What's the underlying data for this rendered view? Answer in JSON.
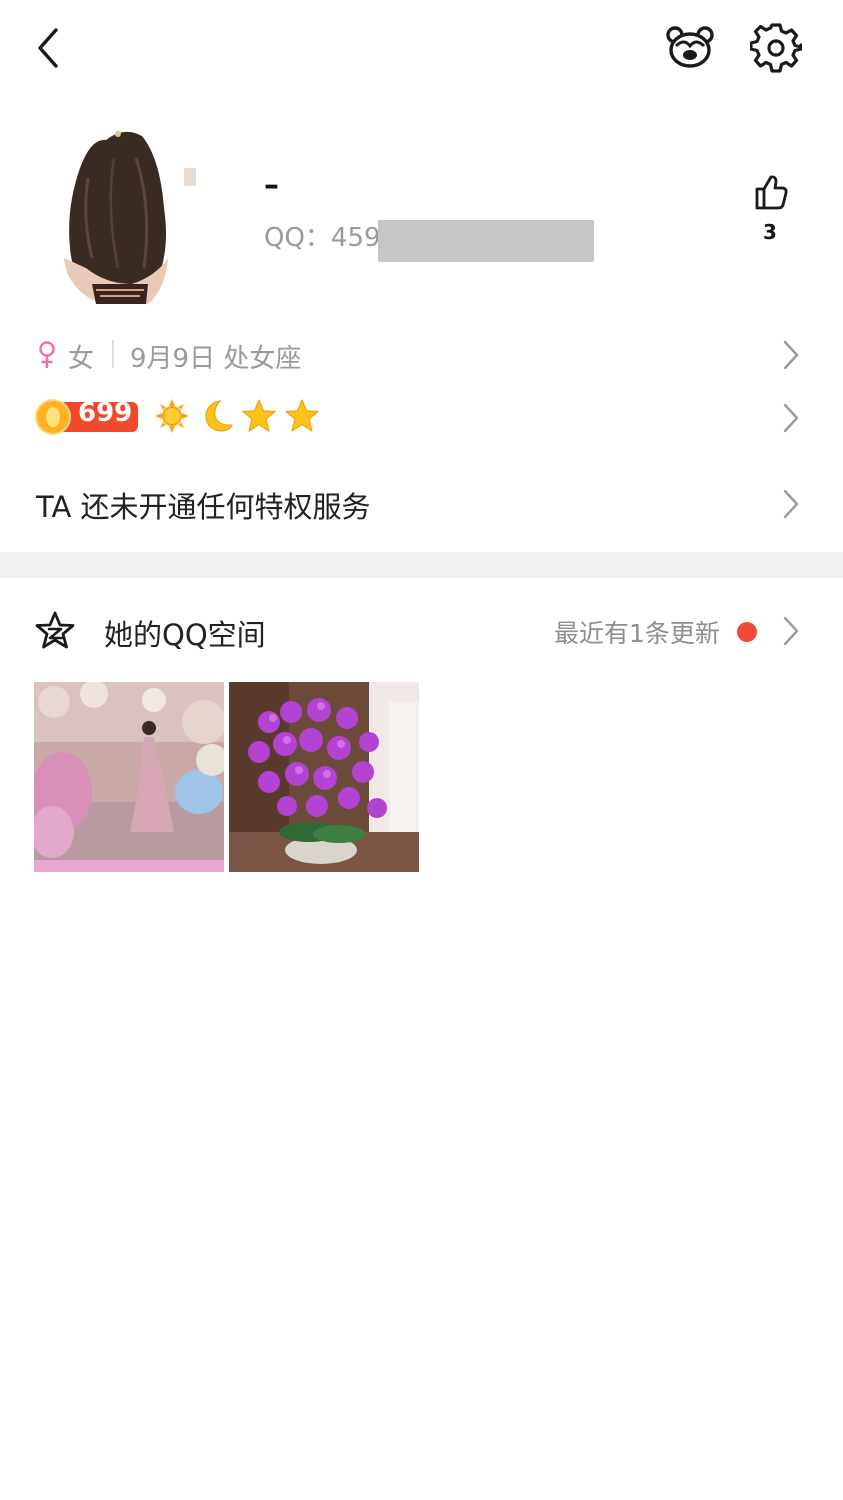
{
  "header": {
    "back_icon": "chevron-left-icon",
    "bear_icon": "bear-face-icon",
    "settings_icon": "gear-icon"
  },
  "profile": {
    "nickname": "–",
    "qq_prefix": "QQ：459",
    "qq_masked": true,
    "likes_icon": "thumbs-up-icon",
    "likes": "3"
  },
  "info": {
    "gender_icon": "female-icon",
    "gender": "女",
    "birthday": "9月9日 处女座",
    "gender_color": "#f06fa8"
  },
  "level": {
    "value": "699",
    "icons": [
      "sun-icon",
      "moon-icon",
      "star-icon",
      "star-icon"
    ]
  },
  "privilege": {
    "text": "TA 还未开通任何特权服务"
  },
  "qzone": {
    "title": "她的QQ空间",
    "update_text": "最近有1条更新",
    "dot_color": "#ef4a3a",
    "photos": [
      {
        "alt": "photo-woman-in-pink-gown"
      },
      {
        "alt": "photo-purple-orchids"
      }
    ]
  }
}
